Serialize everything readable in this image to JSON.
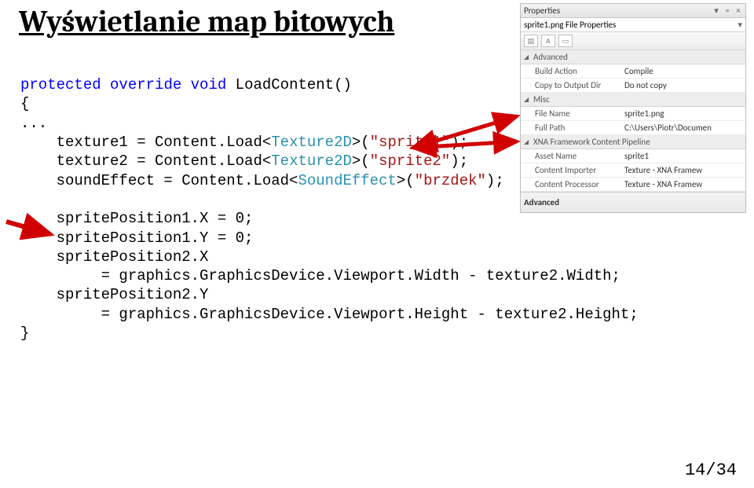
{
  "title": "Wyświetlanie map bitowych",
  "code": {
    "l1a": "protected",
    "l1b": "override",
    "l1c": "void",
    "l1d": " LoadContent()",
    "l2": "{",
    "l3": "...",
    "l4a": "    texture1 = Content.Load<",
    "l4b": "Texture2D",
    "l4c": ">(",
    "l4d": "\"sprite1\"",
    "l4e": ");",
    "l5a": "    texture2 = Content.Load<",
    "l5b": "Texture2D",
    "l5c": ">(",
    "l5d": "\"sprite2\"",
    "l5e": ");",
    "l6a": "    soundEffect = Content.Load<",
    "l6b": "SoundEffect",
    "l6c": ">(",
    "l6d": "\"brzdek\"",
    "l6e": ");",
    "l7": "    spritePosition1.X = 0;",
    "l8": "    spritePosition1.Y = 0;",
    "l9": "    spritePosition2.X",
    "l10": "         = graphics.GraphicsDevice.Viewport.Width - texture2.Width;",
    "l11": "    spritePosition2.Y",
    "l12": "         = graphics.GraphicsDevice.Viewport.Height - texture2.Height;",
    "l13": "}"
  },
  "properties": {
    "title": "Properties",
    "subtitle": "sprite1.png File Properties",
    "categories": [
      {
        "name": "Advanced",
        "rows": [
          {
            "k": "Build Action",
            "v": "Compile"
          },
          {
            "k": "Copy to Output Dir",
            "v": "Do not copy"
          }
        ]
      },
      {
        "name": "Misc",
        "rows": [
          {
            "k": "File Name",
            "v": "sprite1.png"
          },
          {
            "k": "Full Path",
            "v": "C:\\Users\\Piotr\\Documen"
          }
        ]
      },
      {
        "name": "XNA Framework Content Pipeline",
        "rows": [
          {
            "k": "Asset Name",
            "v": "sprite1"
          },
          {
            "k": "Content Importer",
            "v": "Texture - XNA Framew"
          },
          {
            "k": "Content Processor",
            "v": "Texture - XNA Framew"
          }
        ]
      }
    ],
    "footer": "Advanced"
  },
  "pagenum": "14/34"
}
